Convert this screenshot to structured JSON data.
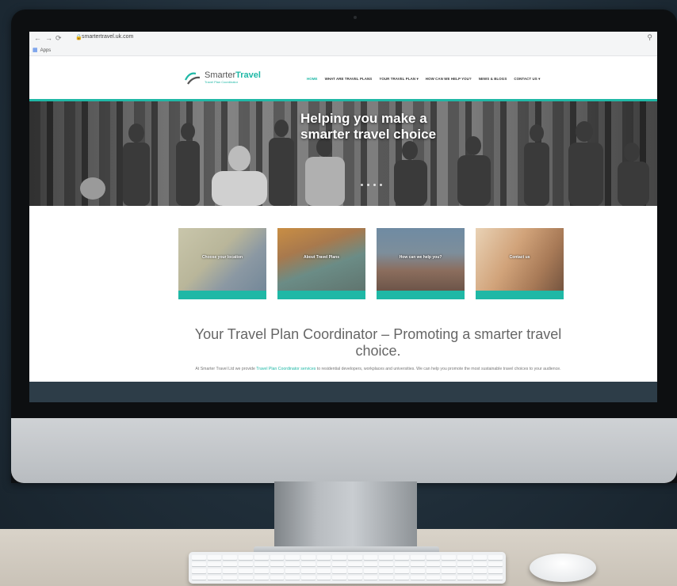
{
  "browser": {
    "back_icon": "arrow-left-icon",
    "url": "smartertravel.uk.com",
    "bookmarks_label": "Apps"
  },
  "site": {
    "logo_name_plain": "Smarter",
    "logo_name_accent": "Travel",
    "logo_tagline": "Travel Plan Coordinator",
    "menu": [
      "HOME",
      "WHAT ARE TRAVEL PLANS",
      "YOUR TRAVEL PLAN ▾",
      "HOW CAN WE HELP YOU?",
      "NEWS & BLOGS",
      "CONTACT US ▾"
    ],
    "hero_title": "Helping you make a smarter travel choice",
    "tiles": [
      {
        "label": "Choose your location"
      },
      {
        "label": "About Travel Plans"
      },
      {
        "label": "How can we help you?"
      },
      {
        "label": "Contact us"
      }
    ],
    "headline": "Your Travel Plan Coordinator – Promoting a smarter travel choice.",
    "intro_pre": "At Smarter Travel Ltd we provide ",
    "intro_link": "Travel Plan Coordinator services",
    "intro_post": " to residential developers, workplaces and universities. We can help you promote the most sustainable travel choices to your audience."
  },
  "colors": {
    "accent": "#1fb8a6",
    "footer": "#2d3d48"
  }
}
